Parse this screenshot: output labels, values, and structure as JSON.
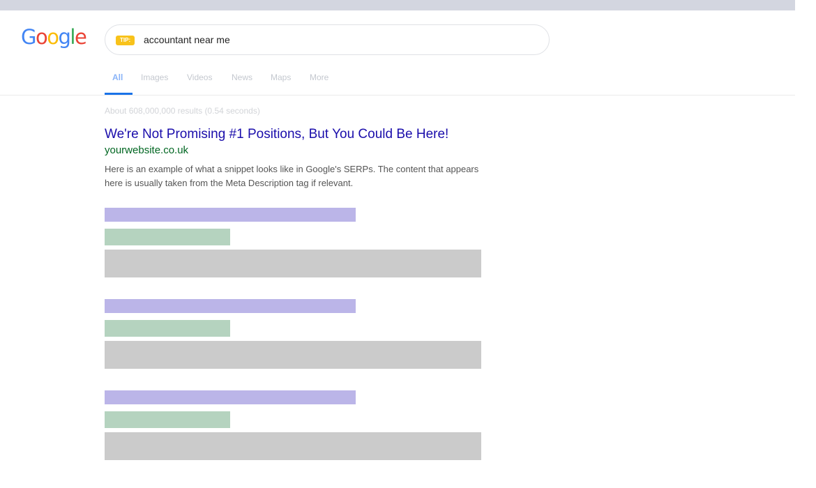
{
  "logo": {
    "letters": [
      {
        "ch": "G",
        "color": "#4285F4"
      },
      {
        "ch": "o",
        "color": "#EA4335"
      },
      {
        "ch": "o",
        "color": "#FBBC05"
      },
      {
        "ch": "g",
        "color": "#4285F4"
      },
      {
        "ch": "l",
        "color": "#34A853"
      },
      {
        "ch": "e",
        "color": "#EA4335"
      }
    ]
  },
  "search": {
    "tip_label": "TIP:",
    "query": "accountant near me"
  },
  "tabs": [
    "All",
    "Images",
    "Videos",
    "News",
    "Maps",
    "More"
  ],
  "stats": "About 608,000,000 results (0.54 seconds)",
  "result": {
    "title": "We're Not Promising #1 Positions, But You Could Be Here!",
    "url": "yourwebsite.co.uk",
    "snippet_line1": "Here is an example of what a snippet looks like in Google's SERPs. The content that appears",
    "snippet_line2": "here is usually taken from the Meta Description tag if relevant."
  },
  "colors": {
    "title_link": "#1a0dab",
    "url_green": "#006621",
    "tab_active": "#1a73e8",
    "placeholder_title": "#bbb5e8",
    "placeholder_url": "#b5d3bf",
    "placeholder_snippet": "#cbcbcb"
  }
}
